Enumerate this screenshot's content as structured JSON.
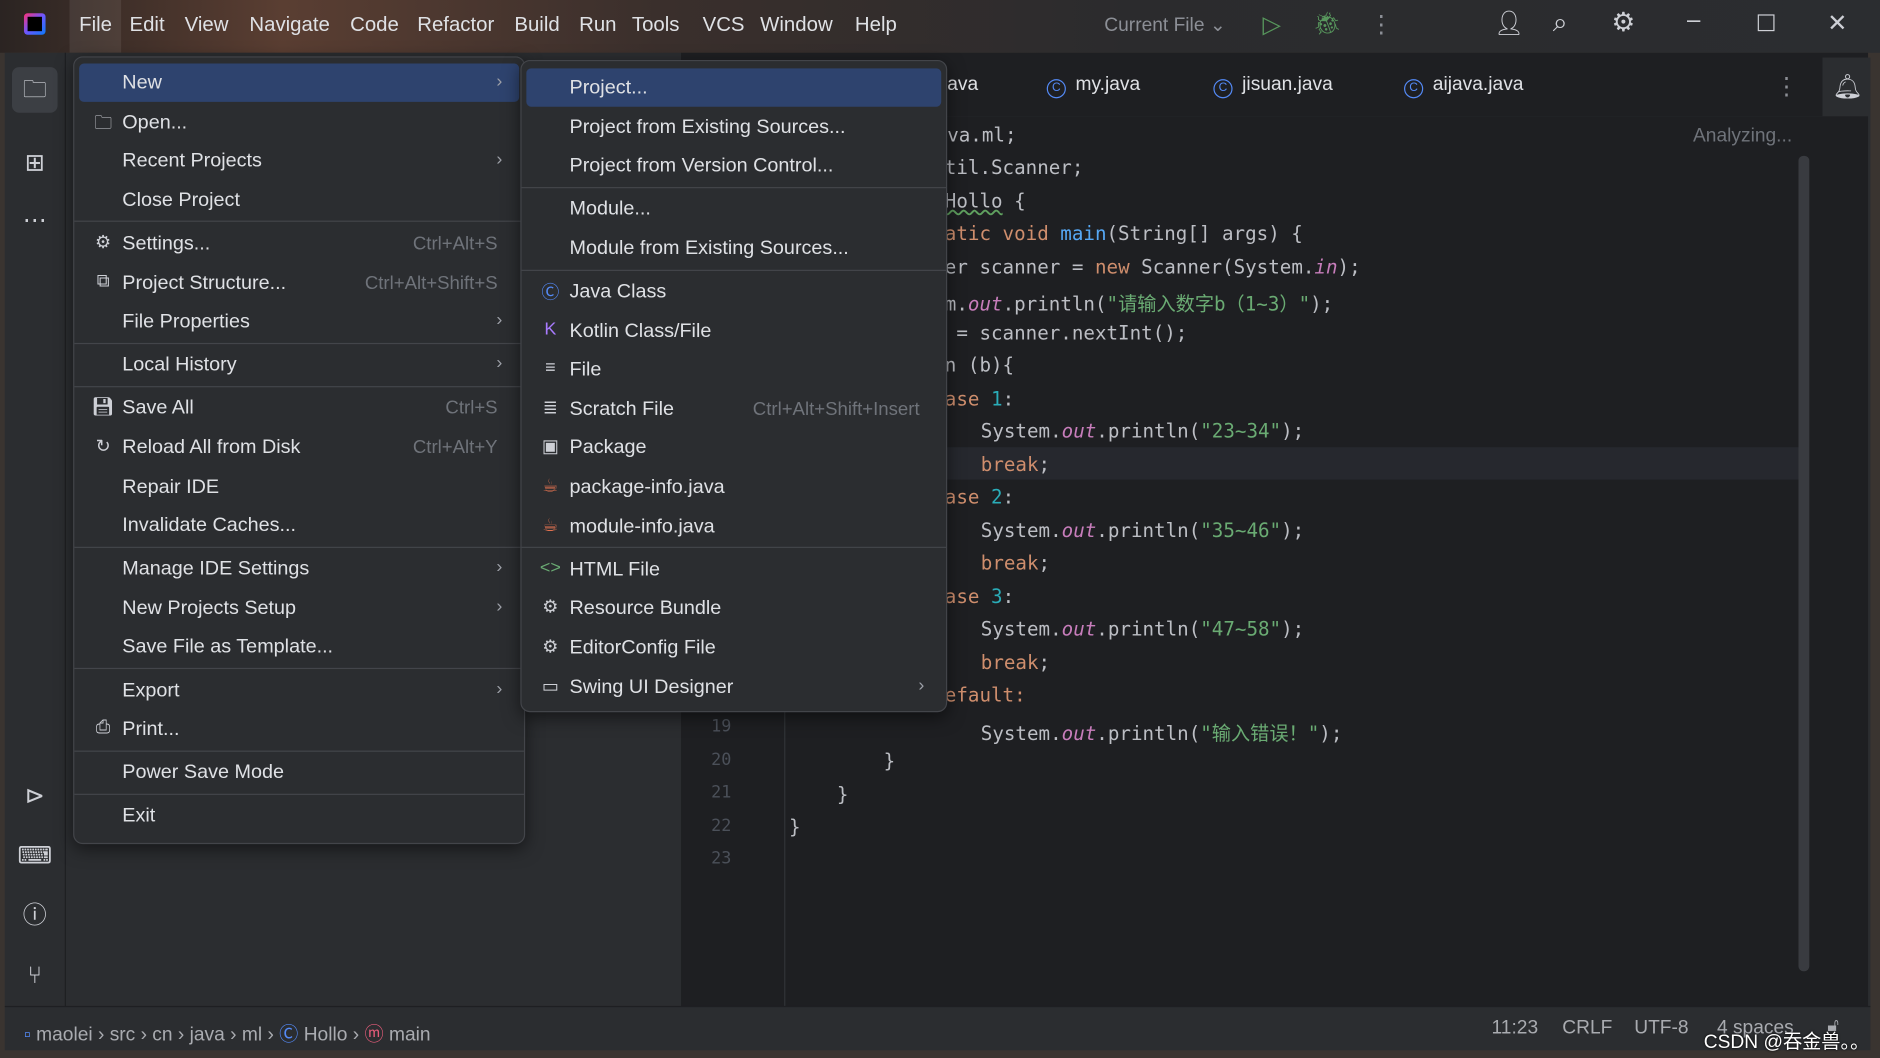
{
  "title_bar": {
    "menus": [
      "File",
      "Edit",
      "View",
      "Navigate",
      "Code",
      "Refactor",
      "Build",
      "Run",
      "Tools",
      "VCS",
      "Window",
      "Help"
    ],
    "run_config": "Current File"
  },
  "tabs": [
    {
      "label": "ava"
    },
    {
      "label": "my.java"
    },
    {
      "label": "jisuan.java"
    },
    {
      "label": "aijava.java"
    }
  ],
  "editor": {
    "status": "Analyzing...",
    "line_numbers": [
      "19",
      "20",
      "21",
      "22",
      "23"
    ],
    "lines": [
      [
        [
          "va.ml;",
          ""
        ]
      ],
      [
        [
          "til.Scanner;",
          ""
        ]
      ],
      [
        [
          "Hollo",
          "wv"
        ],
        [
          " {",
          ""
        ]
      ],
      [
        [
          "atic void ",
          "kw"
        ],
        [
          "main",
          "fn"
        ],
        [
          "(String[] args) {",
          ""
        ]
      ],
      [
        [
          "er scanner = ",
          ""
        ],
        [
          "new ",
          "kw"
        ],
        [
          "Scanner(System.",
          ""
        ],
        [
          "in",
          "sf"
        ],
        [
          ");",
          ""
        ]
      ],
      [
        [
          "m.",
          ""
        ],
        [
          "out",
          "sf"
        ],
        [
          ".println(",
          ""
        ],
        [
          "\"请输入数字b（1~3）\"",
          "st"
        ],
        [
          ");",
          ""
        ]
      ],
      [
        [
          " = scanner.nextInt();",
          ""
        ]
      ],
      [
        [
          "n (b){",
          ""
        ]
      ],
      [
        [
          "ase ",
          "kw"
        ],
        [
          "1",
          "nm"
        ],
        [
          ":",
          ""
        ]
      ],
      [
        [
          "System.",
          ""
        ],
        [
          "out",
          "sf"
        ],
        [
          ".println(",
          ""
        ],
        [
          "\"23~34\"",
          "st"
        ],
        [
          ");",
          ""
        ]
      ],
      [
        [
          "break",
          "kw"
        ],
        [
          ";",
          ""
        ]
      ],
      [
        [
          "ase ",
          "kw"
        ],
        [
          "2",
          "nm"
        ],
        [
          ":",
          ""
        ]
      ],
      [
        [
          "System.",
          ""
        ],
        [
          "out",
          "sf"
        ],
        [
          ".println(",
          ""
        ],
        [
          "\"35~46\"",
          "st"
        ],
        [
          ");",
          ""
        ]
      ],
      [
        [
          "break",
          "kw"
        ],
        [
          ";",
          ""
        ]
      ],
      [
        [
          "ase ",
          "kw"
        ],
        [
          "3",
          "nm"
        ],
        [
          ":",
          ""
        ]
      ],
      [
        [
          "System.",
          ""
        ],
        [
          "out",
          "sf"
        ],
        [
          ".println(",
          ""
        ],
        [
          "\"47~58\"",
          "st"
        ],
        [
          ");",
          ""
        ]
      ],
      [
        [
          "break",
          "kw"
        ],
        [
          ";",
          ""
        ]
      ],
      [
        [
          "efault:",
          "kw"
        ]
      ],
      [
        [
          "System.",
          ""
        ],
        [
          "out",
          "sf"
        ],
        [
          ".println(",
          ""
        ],
        [
          "\"输入错误！\"",
          "st"
        ],
        [
          ");",
          ""
        ]
      ],
      [
        [
          "}",
          ""
        ]
      ],
      [
        [
          "}",
          ""
        ]
      ],
      [
        [
          "}",
          ""
        ]
      ]
    ]
  },
  "file_menu": [
    {
      "label": "New",
      "arrow": true,
      "selected": true
    },
    {
      "label": "Open...",
      "icon": "folder"
    },
    {
      "label": "Recent Projects",
      "arrow": true
    },
    {
      "label": "Close Project",
      "sep_after": true
    },
    {
      "label": "Settings...",
      "shortcut": "Ctrl+Alt+S",
      "icon": "gear"
    },
    {
      "label": "Project Structure...",
      "shortcut": "Ctrl+Alt+Shift+S",
      "icon": "structure"
    },
    {
      "label": "File Properties",
      "arrow": true,
      "sep_after": true
    },
    {
      "label": "Local History",
      "arrow": true,
      "sep_after": true
    },
    {
      "label": "Save All",
      "shortcut": "Ctrl+S",
      "icon": "save"
    },
    {
      "label": "Reload All from Disk",
      "shortcut": "Ctrl+Alt+Y",
      "icon": "reload"
    },
    {
      "label": "Repair IDE"
    },
    {
      "label": "Invalidate Caches...",
      "sep_after": true
    },
    {
      "label": "Manage IDE Settings",
      "arrow": true
    },
    {
      "label": "New Projects Setup",
      "arrow": true
    },
    {
      "label": "Save File as Template...",
      "sep_after": true
    },
    {
      "label": "Export",
      "arrow": true
    },
    {
      "label": "Print...",
      "icon": "print",
      "sep_after": true
    },
    {
      "label": "Power Save Mode",
      "sep_after": true
    },
    {
      "label": "Exit"
    }
  ],
  "new_menu": [
    {
      "label": "Project...",
      "selected": true
    },
    {
      "label": "Project from Existing Sources..."
    },
    {
      "label": "Project from Version Control...",
      "sep_after": true
    },
    {
      "label": "Module..."
    },
    {
      "label": "Module from Existing Sources...",
      "sep_after": true
    },
    {
      "label": "Java Class",
      "icon": "java-class"
    },
    {
      "label": "Kotlin Class/File",
      "icon": "kotlin"
    },
    {
      "label": "File",
      "icon": "file"
    },
    {
      "label": "Scratch File",
      "shortcut": "Ctrl+Alt+Shift+Insert",
      "icon": "scratch"
    },
    {
      "label": "Package",
      "icon": "package"
    },
    {
      "label": "package-info.java",
      "icon": "java-file"
    },
    {
      "label": "module-info.java",
      "icon": "java-file",
      "sep_after": true
    },
    {
      "label": "HTML File",
      "icon": "html"
    },
    {
      "label": "Resource Bundle",
      "icon": "gear"
    },
    {
      "label": "EditorConfig File",
      "icon": "gear"
    },
    {
      "label": "Swing UI Designer",
      "icon": "window",
      "arrow": true
    }
  ],
  "breadcrumb": [
    "maolei",
    "src",
    "cn",
    "java",
    "ml",
    "Hollo",
    "main"
  ],
  "status": {
    "position": "11:23",
    "line_sep": "CRLF",
    "encoding": "UTF-8",
    "indent": "4 spaces"
  },
  "watermark": "CSDN @吞金兽。。",
  "colors": {
    "selection": "#2e436e",
    "keyword": "#cf8e6d",
    "string": "#6aab73",
    "method": "#56a8f5",
    "number": "#2aacb8",
    "static_field": "#c77dbb"
  }
}
